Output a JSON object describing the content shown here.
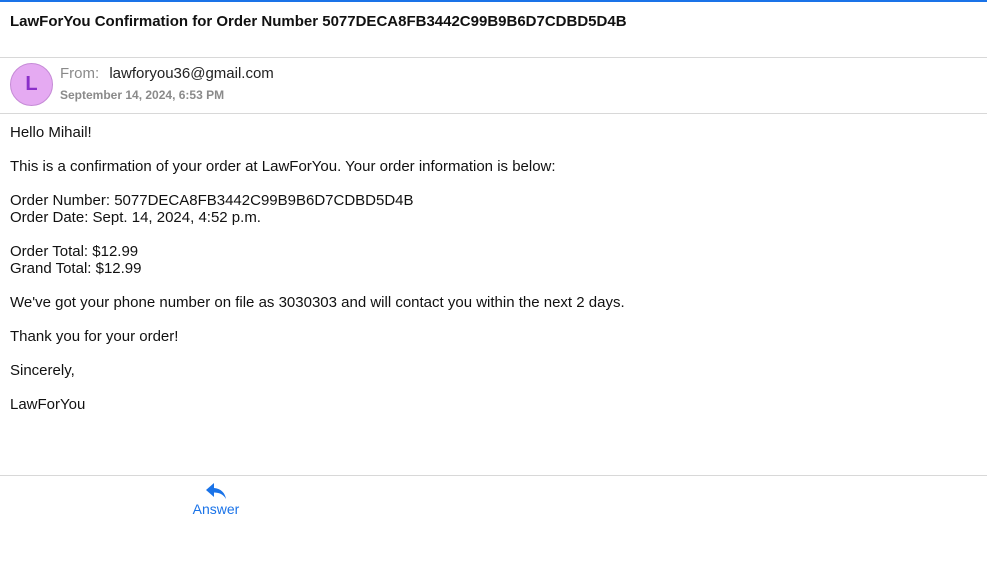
{
  "email": {
    "subject": "LawForYou Confirmation for Order Number 5077DECA8FB3442C99B9B6D7CDBD5D4B",
    "sender": {
      "avatar_initial": "L",
      "avatar_color": "#e5aaf2",
      "from_label": "From:",
      "email": "lawforyou36@gmail.com"
    },
    "date": "September 14, 2024, 6:53 PM",
    "body": {
      "greeting": "Hello Mihail!",
      "intro": "This is a confirmation of your order at LawForYou. Your order information is below:",
      "order_number": "Order Number: 5077DECA8FB3442C99B9B6D7CDBD5D4B",
      "order_date": "Order Date: Sept. 14, 2024, 4:52 p.m.",
      "order_total": "Order Total: $12.99",
      "grand_total": "Grand Total: $12.99",
      "phone_note": "We've got your phone number on file as 3030303 and will contact you within the next 2 days.",
      "thanks": "Thank you for your order!",
      "closing": "Sincerely,",
      "signature": "LawForYou"
    }
  },
  "actions": {
    "answer_label": "Answer",
    "answer_icon": "reply-icon"
  },
  "colors": {
    "accent": "#1a73e8"
  }
}
